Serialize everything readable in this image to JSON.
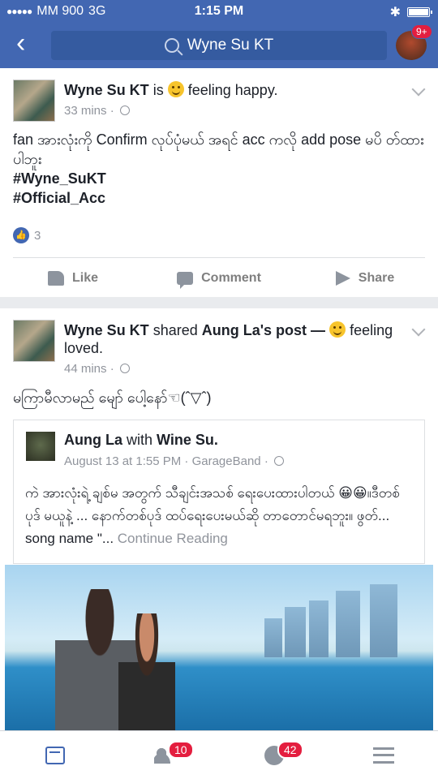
{
  "status_bar": {
    "carrier": "MM 900",
    "network": "3G",
    "time": "1:15 PM"
  },
  "nav": {
    "search_text": "Wyne Su KT",
    "profile_badge": "9+"
  },
  "post1": {
    "author": "Wyne Su KT",
    "verb": "is",
    "feeling": "feeling happy.",
    "time": "33 mins",
    "text": "fan အားလုံးကို Confirm လုပ်ပုံမယ် အရင် acc ကလို add pose မပိ တ်ထားပါဘူး",
    "hashtag1": "#Wyne_SuKT",
    "hashtag2": "#Official_Acc",
    "like_count": "3",
    "actions": {
      "like": "Like",
      "comment": "Comment",
      "share": "Share"
    }
  },
  "post2": {
    "author": "Wyne Su KT",
    "verb": "shared",
    "shared_from": "Aung La",
    "shared_suffix": "'s post —",
    "feeling": "feeling",
    "feeling2": "loved.",
    "time": "44 mins",
    "text": "မကြာမီလာမည် မျော် ပေါ့နော်☜(ˆ▽ˆ)",
    "shared_post": {
      "author": "Aung La",
      "with": "with",
      "tagged": "Wine Su.",
      "meta": "August 13 at 1:55 PM · GarageBand ·",
      "text": "ကဲ အားလုံးရဲ့ ချစ်မ အတွက် သီချင်းအသစ် ရေးပေးထားပါတယ် 😀😀။ဒီတစ်ပုဒ် မယူနဲ့ ...  နောက်တစ်ပုဒ် ထပ်ရေးပေးမယ်ဆို တာတောင်မရဘူး။ ဖွတ်... song name \"...",
      "continue": "Continue Reading"
    }
  },
  "tabbar": {
    "friends_badge": "10",
    "notifications_badge": "42"
  },
  "icons": [
    "back-icon",
    "search-icon",
    "globe-icon",
    "like-icon",
    "comment-icon",
    "share-icon",
    "news-feed-icon",
    "friend-requests-icon",
    "notifications-icon",
    "menu-icon"
  ],
  "colors": {
    "brand": "#4267b2",
    "badge": "#e41e3f"
  }
}
